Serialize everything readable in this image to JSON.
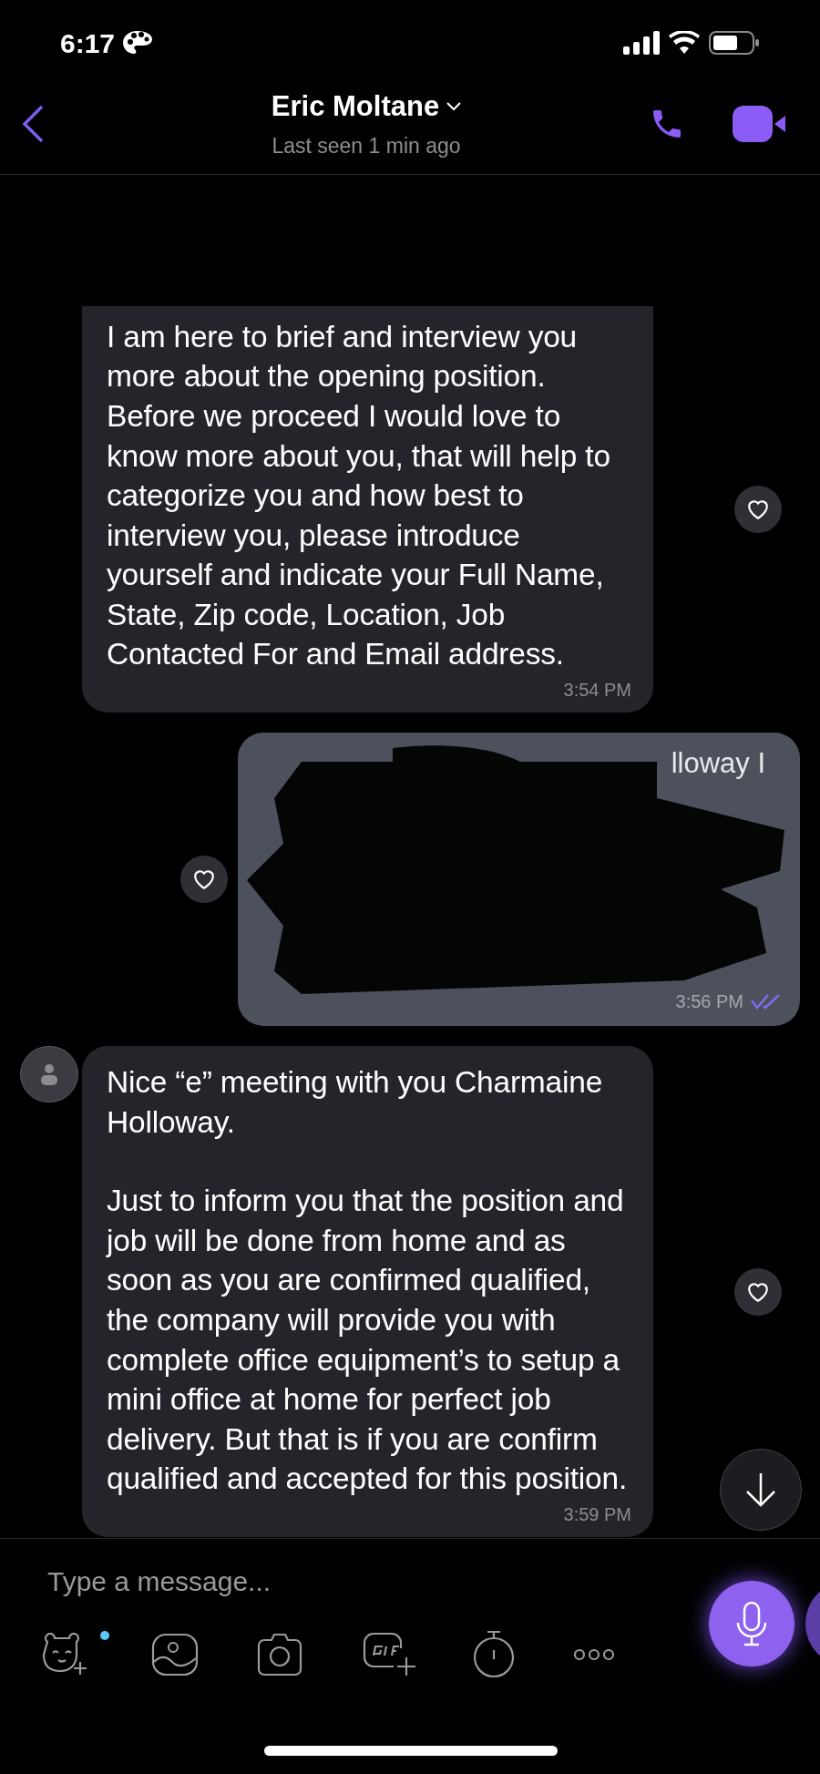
{
  "status_bar": {
    "time": "6:17"
  },
  "header": {
    "name": "Eric Moltane",
    "subtitle": "Last seen 1 min ago"
  },
  "messages": [
    {
      "kind": "text",
      "show_avatar": false,
      "paragraphs": [
        "I am here to brief and interview you more about the opening position. Before we proceed I would love to know more about you, that will help to categorize you and how best to interview you, please introduce yourself and indicate your Full Name, State, Zip code, Location, Job Contacted For and Email address."
      ],
      "time": "3:54 PM"
    },
    {
      "kind": "redacted",
      "show_avatar": false,
      "fragments": [
        "lloway I"
      ],
      "time": "3:56 PM",
      "read": true
    },
    {
      "kind": "text",
      "show_avatar": true,
      "paragraphs": [
        "Nice “e” meeting with you Charmaine Holloway.",
        "Just to inform you that the position and job will be done from home and as soon as you are confirmed qualified, the company will provide you with complete office equipment’s to setup a mini office at home for perfect job delivery. But that is if you are confirm qualified and accepted for this position."
      ],
      "time": "3:59 PM"
    }
  ],
  "composer": {
    "placeholder": "Type a message...",
    "sticker_badge": true
  }
}
